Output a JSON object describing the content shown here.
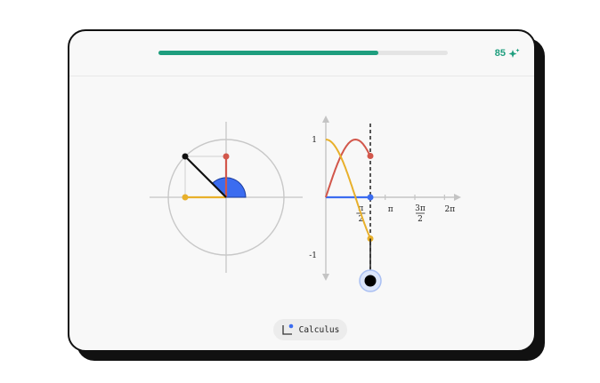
{
  "lesson": {
    "progress_fraction": 0.76,
    "score": "85",
    "score_icon": "sparkle-icon",
    "accent_color": "#1e9e7e"
  },
  "diagram": {
    "colors": {
      "sine": "#d2574b",
      "cosine": "#e8b02b",
      "angle": "#3b6cf0",
      "point": "#111111",
      "axis": "#c4c4c4",
      "circle": "#c8c8c8"
    },
    "angle_degrees": 135,
    "y_axis_ticks": [
      {
        "label": "1",
        "value": 1
      },
      {
        "label": "-1",
        "value": -1
      }
    ],
    "x_axis_ticks": [
      {
        "num": "π",
        "den": "2",
        "value": 1.5708
      },
      {
        "num": "π",
        "den": "",
        "value": 3.1416
      },
      {
        "num": "3π",
        "den": "2",
        "value": 4.7124
      },
      {
        "num": "2π",
        "den": "",
        "value": 6.2832
      }
    ]
  },
  "footer": {
    "topic_label": "Calculus",
    "topic_icon": "chart-axes-icon"
  }
}
